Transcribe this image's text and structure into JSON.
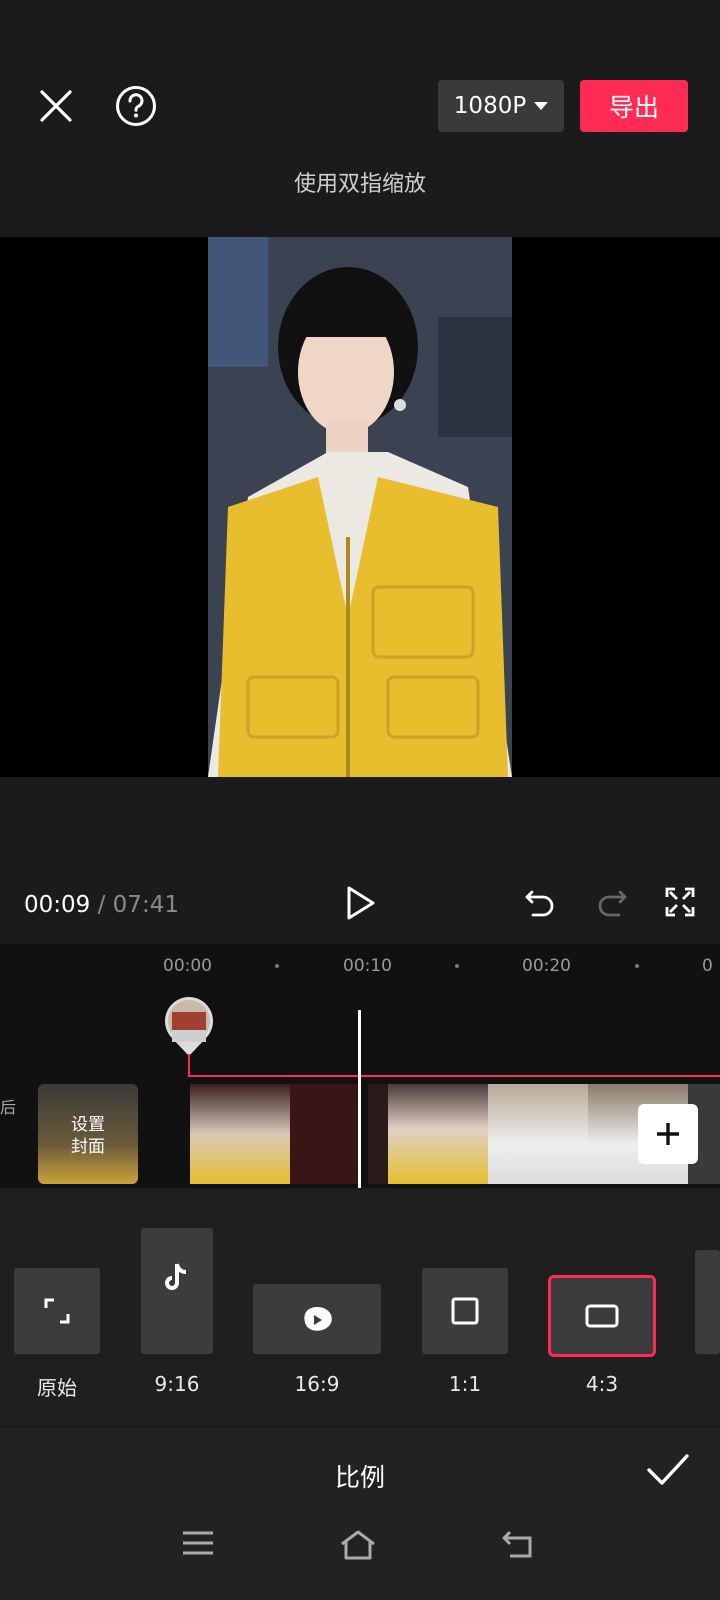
{
  "topbar": {
    "resolution": "1080P",
    "export_label": "导出",
    "hint": "使用双指缩放"
  },
  "playback": {
    "current_time": "00:09",
    "separator": " / ",
    "total_time": "07:41"
  },
  "timeline": {
    "ruler": [
      "00:00",
      "00:10",
      "00:20"
    ],
    "cover_label_line1": "设置",
    "cover_label_line2": "封面",
    "edge_char": "后"
  },
  "ratio": {
    "options": [
      {
        "label": "原始",
        "icon": "expand-corners-icon"
      },
      {
        "label": "9:16",
        "icon": "tiktok-icon"
      },
      {
        "label": "16:9",
        "icon": "youtube-icon"
      },
      {
        "label": "1:1",
        "icon": "square-icon"
      },
      {
        "label": "4:3",
        "icon": "rect-icon",
        "selected": true
      }
    ],
    "accent": "#fe2c55"
  },
  "panel": {
    "title": "比例"
  }
}
